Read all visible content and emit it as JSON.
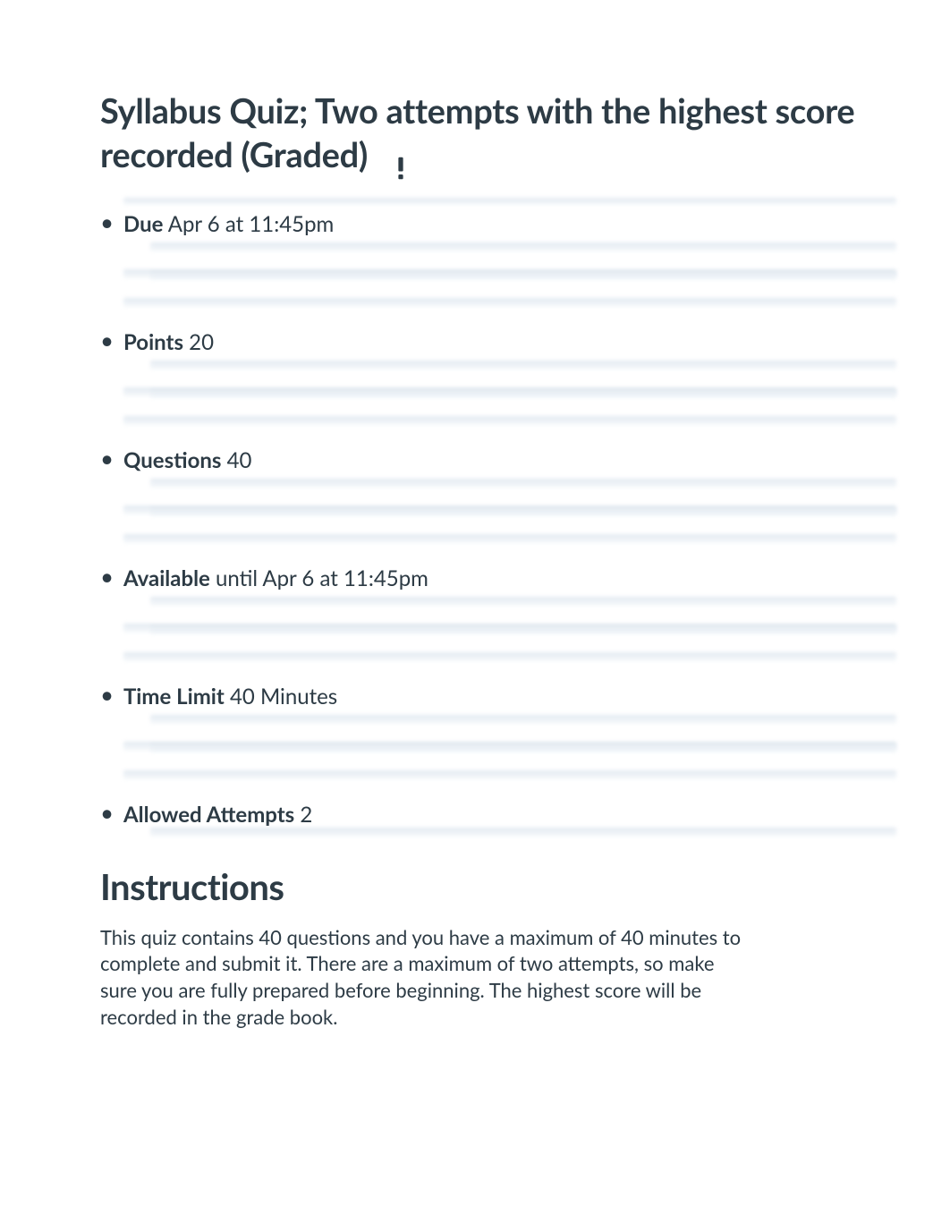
{
  "title": "Syllabus Quiz; Two attempts with the highest score recorded (Graded)",
  "alert_icon": "alert-icon",
  "details": [
    {
      "label": "Due",
      "value": " Apr 6 at 11:45pm"
    },
    {
      "label": "Points",
      "value": " 20"
    },
    {
      "label": "Questions",
      "value": " 40"
    },
    {
      "label": "Available",
      "value": " until Apr 6 at 11:45pm"
    },
    {
      "label": "Time Limit",
      "value": " 40 Minutes"
    },
    {
      "label": "Allowed Attempts",
      "value": " 2"
    }
  ],
  "instructions_heading": "Instructions",
  "instructions_body": "This quiz contains 40 questions and you have a maximum of 40 minutes to complete and submit it. There are a maximum of two attempts, so make sure you are fully prepared before beginning. The highest score will be recorded in the grade book."
}
